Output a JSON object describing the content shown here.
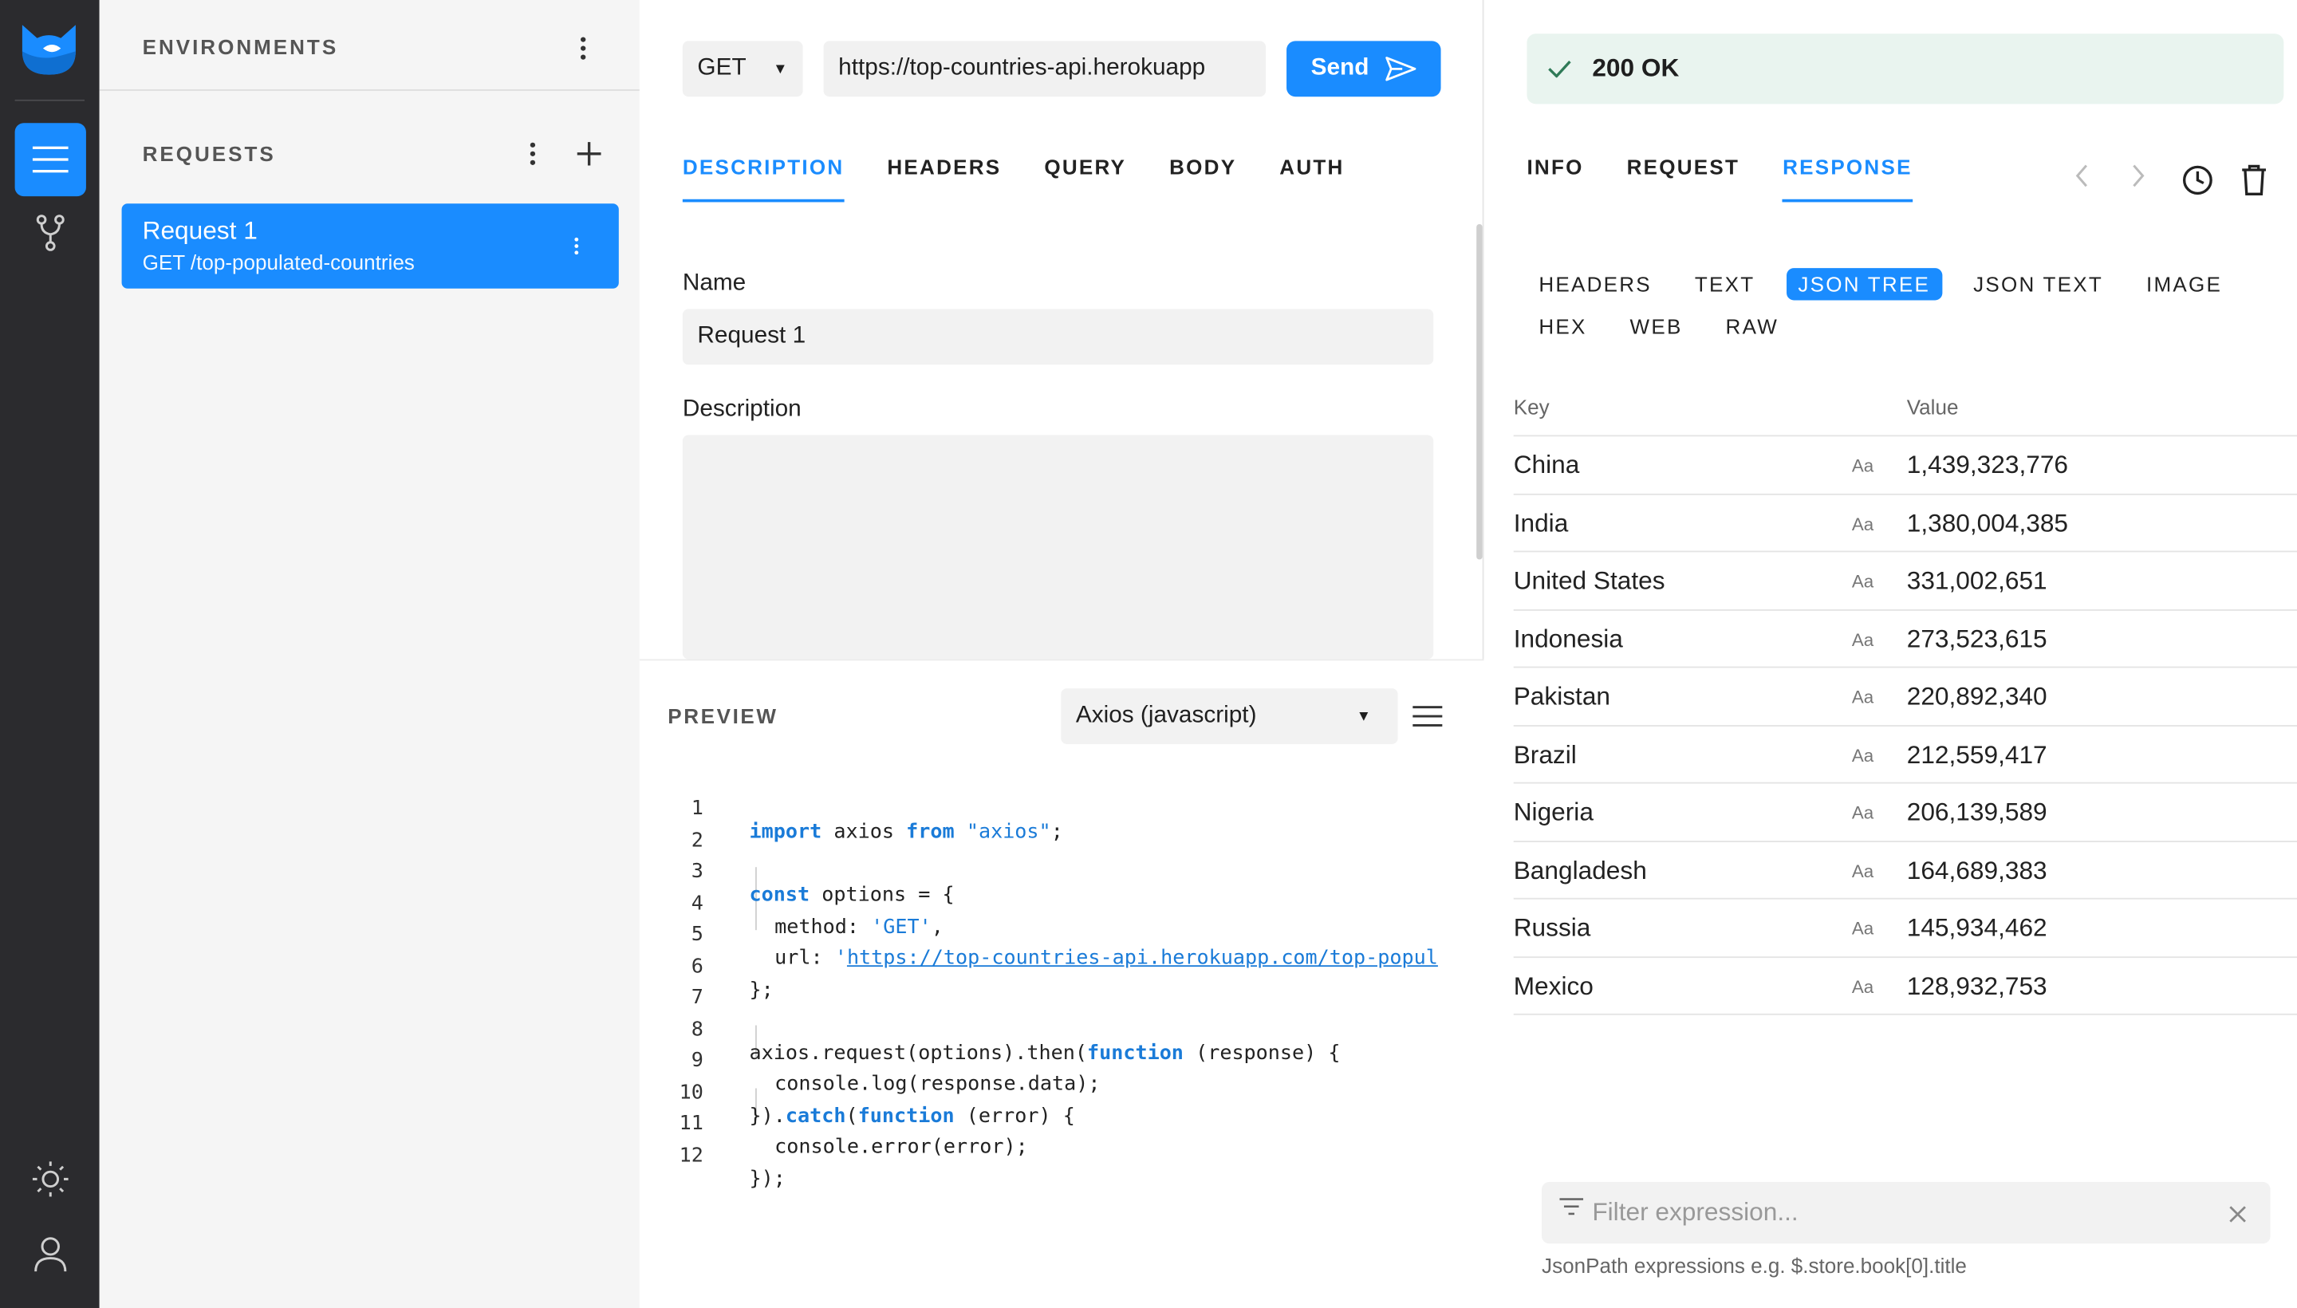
{
  "sidebar": {
    "environments_label": "ENVIRONMENTS",
    "requests_label": "REQUESTS",
    "requests": [
      {
        "title": "Request 1",
        "subtitle": "GET /top-populated-countries"
      }
    ]
  },
  "request": {
    "method": "GET",
    "url": "https://top-countries-api.herokuapp",
    "send_label": "Send",
    "tabs": [
      "DESCRIPTION",
      "HEADERS",
      "QUERY",
      "BODY",
      "AUTH"
    ],
    "active_tab": "DESCRIPTION",
    "name_label": "Name",
    "name_value": "Request 1",
    "description_label": "Description",
    "description_value": ""
  },
  "preview": {
    "label": "PREVIEW",
    "language": "Axios (javascript)",
    "line_numbers": [
      "1",
      "2",
      "3",
      "4",
      "5",
      "6",
      "7",
      "8",
      "9",
      "10",
      "11",
      "12"
    ],
    "code": {
      "l1_kw1": "import",
      "l1_a": " axios ",
      "l1_kw2": "from",
      "l1_sp": " ",
      "l1_str": "\"axios\"",
      "l1_end": ";",
      "l3_kw": "const",
      "l3_rest": " options = {",
      "l4_key": "method: ",
      "l4_str": "'GET'",
      "l4_end": ",",
      "l5_key": "url: ",
      "l5_q": "'",
      "l5_url": "https://top-countries-api.herokuapp.com/top-popul",
      "l6": "};",
      "l8_a": "axios.request(options).then(",
      "l8_kw": "function",
      "l8_b": " (response) {",
      "l9": "console.log(response.data);",
      "l10_a": "}).",
      "l10_kw1": "catch",
      "l10_b": "(",
      "l10_kw2": "function",
      "l10_c": " (error) {",
      "l11": "console.error(error);",
      "l12": "});"
    }
  },
  "response": {
    "status": "200 OK",
    "status_color": "#e9f4ef",
    "tabs": [
      "INFO",
      "REQUEST",
      "RESPONSE"
    ],
    "active_tab": "RESPONSE",
    "view_tabs_row1": [
      "HEADERS",
      "TEXT",
      "JSON TREE",
      "JSON TEXT",
      "IMAGE"
    ],
    "view_tabs_row2": [
      "HEX",
      "WEB",
      "RAW"
    ],
    "active_view": "JSON TREE",
    "table": {
      "key_header": "Key",
      "value_header": "Value",
      "type_badge": "Aa",
      "rows": [
        {
          "key": "China",
          "value": "1,439,323,776"
        },
        {
          "key": "India",
          "value": "1,380,004,385"
        },
        {
          "key": "United States",
          "value": "331,002,651"
        },
        {
          "key": "Indonesia",
          "value": "273,523,615"
        },
        {
          "key": "Pakistan",
          "value": "220,892,340"
        },
        {
          "key": "Brazil",
          "value": "212,559,417"
        },
        {
          "key": "Nigeria",
          "value": "206,139,589"
        },
        {
          "key": "Bangladesh",
          "value": "164,689,383"
        },
        {
          "key": "Russia",
          "value": "145,934,462"
        },
        {
          "key": "Mexico",
          "value": "128,932,753"
        }
      ]
    },
    "filter_placeholder": "Filter expression...",
    "filter_hint": "JsonPath expressions e.g. $.store.book[0].title"
  },
  "colors": {
    "accent": "#1a8cff",
    "activity_bar": "#2b2b2e",
    "sidebar_bg": "#f5f5f5"
  },
  "icons": [
    "app-logo-icon",
    "requests-list-icon",
    "git-branch-icon",
    "sun-icon",
    "user-icon",
    "kebab-icon",
    "plus-icon",
    "send-arrow-icon",
    "caret-down-icon",
    "hamburger-icon",
    "check-icon",
    "chevron-left-icon",
    "chevron-right-icon",
    "history-clock-icon",
    "trash-icon",
    "filter-icon",
    "close-icon"
  ]
}
